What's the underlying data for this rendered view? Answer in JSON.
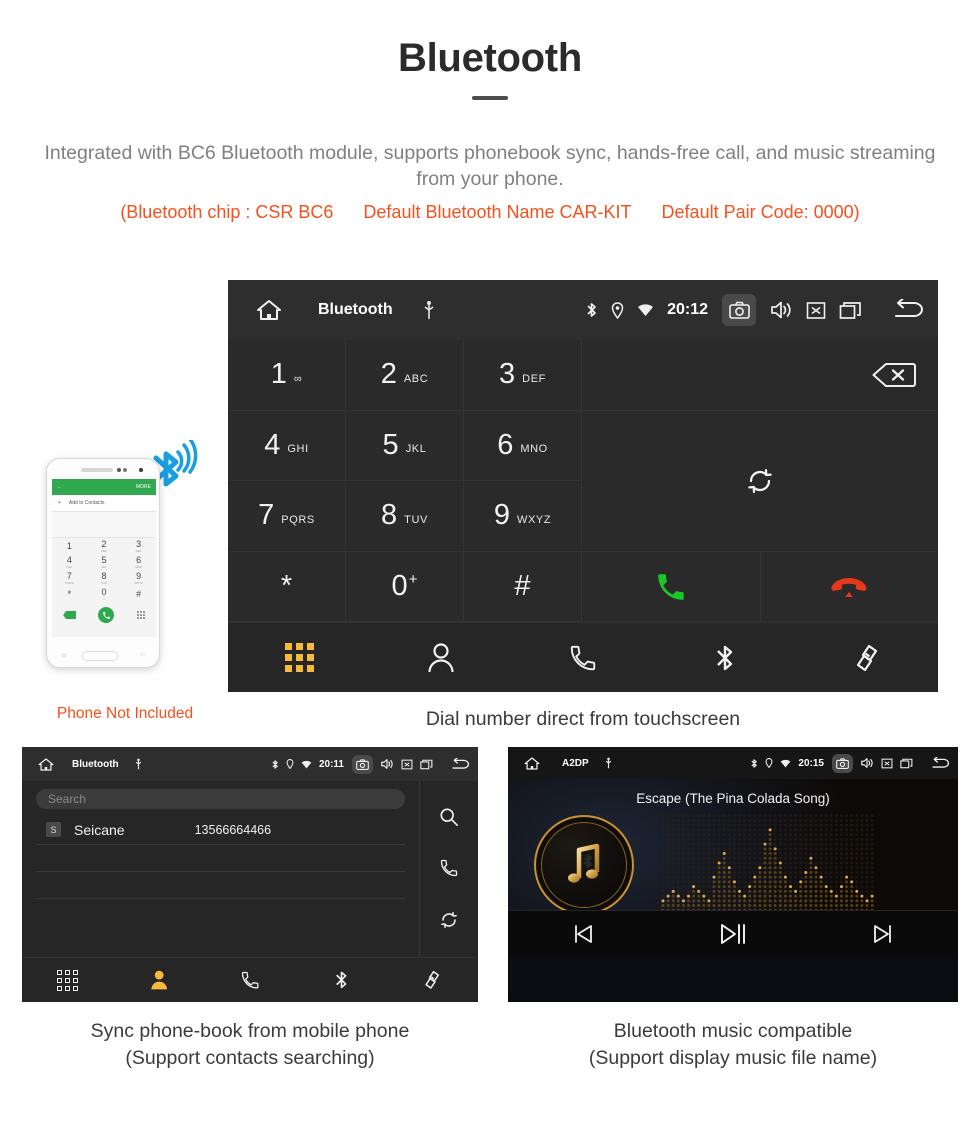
{
  "header": {
    "title": "Bluetooth",
    "subtitle": "Integrated with BC6 Bluetooth module, supports phonebook sync, hands-free call, and music streaming from your phone.",
    "spec_open": "(Bluetooth chip : CSR BC6",
    "spec_name": "Default Bluetooth Name CAR-KIT",
    "spec_pair": "Default Pair Code: 0000)",
    "accent_color": "#f4511e",
    "subtitle_color": "#808080"
  },
  "main_screen": {
    "statusbar": {
      "home_icon": "home-icon",
      "title": "Bluetooth",
      "usb_icon": "usb-icon",
      "bluetooth_icon": "bluetooth-icon",
      "location_icon": "location-pin-icon",
      "wifi_icon": "wifi-icon",
      "time": "20:12",
      "camera_icon": "camera-icon",
      "volume_icon": "volume-icon",
      "close_icon": "close-box-icon",
      "recents_icon": "recent-apps-icon",
      "back_icon": "back-arrow-icon"
    },
    "keypad": [
      {
        "digit": "1",
        "letters": "∞",
        "name": "key-1"
      },
      {
        "digit": "2",
        "letters": "ABC",
        "name": "key-2"
      },
      {
        "digit": "3",
        "letters": "DEF",
        "name": "key-3"
      },
      {
        "digit": "4",
        "letters": "GHI",
        "name": "key-4"
      },
      {
        "digit": "5",
        "letters": "JKL",
        "name": "key-5"
      },
      {
        "digit": "6",
        "letters": "MNO",
        "name": "key-6"
      },
      {
        "digit": "7",
        "letters": "PQRS",
        "name": "key-7"
      },
      {
        "digit": "8",
        "letters": "TUV",
        "name": "key-8"
      },
      {
        "digit": "9",
        "letters": "WXYZ",
        "name": "key-9"
      },
      {
        "digit": "*",
        "letters": "",
        "name": "key-star"
      },
      {
        "digit": "0",
        "letters": "",
        "sup": "+",
        "name": "key-0"
      },
      {
        "digit": "#",
        "letters": "",
        "name": "key-hash"
      }
    ],
    "number_field_value": "",
    "backspace_icon": "backspace-icon",
    "sync_icon": "sync-icon",
    "call_icon": "call-answer-icon",
    "hangup_icon": "call-end-icon",
    "navbar": [
      {
        "icon": "dialpad-icon",
        "name": "nav-dialpad",
        "active": true
      },
      {
        "icon": "contacts-icon",
        "name": "nav-contacts",
        "active": false
      },
      {
        "icon": "call-log-icon",
        "name": "nav-call-log",
        "active": false
      },
      {
        "icon": "bluetooth-icon",
        "name": "nav-bluetooth",
        "active": false
      },
      {
        "icon": "link-icon",
        "name": "nav-link",
        "active": false
      }
    ],
    "caption": "Dial number direct from touchscreen"
  },
  "phone_mockup": {
    "topbar_more": "MORE",
    "add_contacts": "Add to Contacts",
    "keys": [
      {
        "n": "1",
        "s": ""
      },
      {
        "n": "2",
        "s": "ABC"
      },
      {
        "n": "3",
        "s": "DEF"
      },
      {
        "n": "4",
        "s": "GHI"
      },
      {
        "n": "5",
        "s": "JKL"
      },
      {
        "n": "6",
        "s": "MNO"
      },
      {
        "n": "7",
        "s": "PQRS"
      },
      {
        "n": "8",
        "s": "TUV"
      },
      {
        "n": "9",
        "s": "WXYZ"
      },
      {
        "n": "*",
        "s": ""
      },
      {
        "n": "0",
        "s": "+"
      },
      {
        "n": "#",
        "s": ""
      }
    ],
    "caption": "Phone Not Included",
    "caption_color": "#f4511e"
  },
  "phonebook_screen": {
    "statusbar": {
      "title": "Bluetooth",
      "time": "20:11"
    },
    "search_placeholder": "Search",
    "contacts": [
      {
        "initial": "S",
        "name": "Seicane",
        "number": "13566664466"
      }
    ],
    "side_icons": [
      {
        "icon": "search-icon",
        "name": "phonebook-search-button"
      },
      {
        "icon": "call-log-icon",
        "name": "phonebook-calllog-button"
      },
      {
        "icon": "sync-icon",
        "name": "phonebook-sync-button"
      }
    ],
    "navbar": [
      {
        "icon": "dialpad-icon",
        "name": "nav-dialpad",
        "active": false
      },
      {
        "icon": "contacts-icon",
        "name": "nav-contacts",
        "active": true
      },
      {
        "icon": "call-log-icon",
        "name": "nav-call-log",
        "active": false
      },
      {
        "icon": "bluetooth-icon",
        "name": "nav-bluetooth",
        "active": false
      },
      {
        "icon": "link-icon",
        "name": "nav-link",
        "active": false
      }
    ],
    "caption_line1": "Sync phone-book from mobile phone",
    "caption_line2": "(Support contacts searching)"
  },
  "music_screen": {
    "statusbar": {
      "title": "A2DP",
      "time": "20:15"
    },
    "track_title": "Escape (The Pina Colada Song)",
    "album_icon": "bluetooth-music-note-icon",
    "controls": [
      {
        "icon": "previous-track-icon",
        "name": "music-previous-button"
      },
      {
        "icon": "play-pause-icon",
        "name": "music-play-pause-button"
      },
      {
        "icon": "next-track-icon",
        "name": "music-next-button"
      }
    ],
    "caption_line1": "Bluetooth music compatible",
    "caption_line2": "(Support display music file name)"
  }
}
